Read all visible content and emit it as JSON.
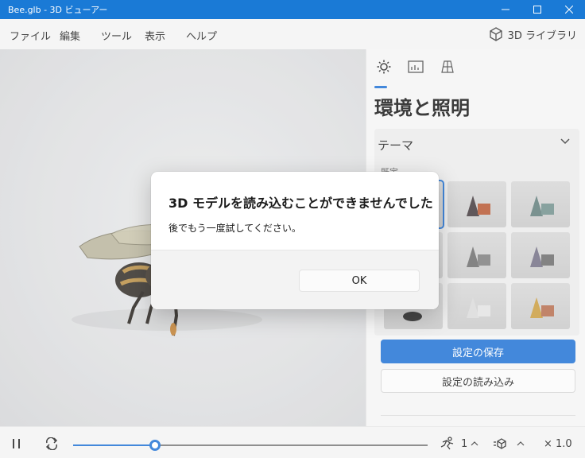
{
  "window": {
    "title": "Bee.glb - 3D ビューアー"
  },
  "menu": {
    "items": [
      "ファイル",
      "編集",
      "ツール",
      "表示",
      "ヘルプ"
    ],
    "library_label": "3D ライブラリ"
  },
  "panel": {
    "tabs": [
      "sun-icon",
      "stats-icon",
      "grid-icon"
    ],
    "title": "環境と照明",
    "theme_label": "テーマ",
    "theme_sub": "既定",
    "save_button": "設定の保存",
    "load_button": "設定の読み込み"
  },
  "bottom": {
    "speed_value": "1",
    "zoom_value": "× 1.0",
    "timeline_progress": 0.23
  },
  "dialog": {
    "title": "3D モデルを読み込むことができませんでした",
    "message": "後でもう一度試してください。",
    "ok_button": "OK"
  },
  "colors": {
    "accent": "#1a6ed3",
    "titlebar": "#1a7ad6"
  }
}
